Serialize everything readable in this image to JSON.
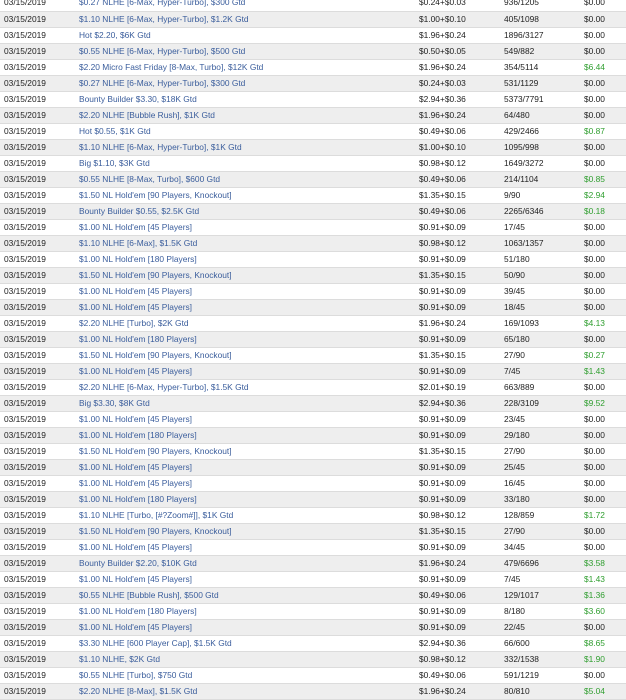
{
  "colors": {
    "link": "#3a5d9c",
    "win": "#2f9e2f",
    "row_alt": "#eeeeee"
  },
  "rows": [
    {
      "date": "03/15/2019",
      "name": "$0.27 NLHE [6-Max, Hyper-Turbo], $300 Gtd",
      "buyin": "$0.24+$0.03",
      "position": "936/1205",
      "winnings": "$0.00"
    },
    {
      "date": "03/15/2019",
      "name": "$1.10 NLHE [6-Max, Hyper-Turbo], $1.2K Gtd",
      "buyin": "$1.00+$0.10",
      "position": "405/1098",
      "winnings": "$0.00"
    },
    {
      "date": "03/15/2019",
      "name": "Hot $2.20, $6K Gtd",
      "buyin": "$1.96+$0.24",
      "position": "1896/3127",
      "winnings": "$0.00"
    },
    {
      "date": "03/15/2019",
      "name": "$0.55 NLHE [6-Max, Hyper-Turbo], $500 Gtd",
      "buyin": "$0.50+$0.05",
      "position": "549/882",
      "winnings": "$0.00"
    },
    {
      "date": "03/15/2019",
      "name": "$2.20 Micro Fast Friday [8-Max, Turbo], $12K Gtd",
      "buyin": "$1.96+$0.24",
      "position": "354/5114",
      "winnings": "$6.44"
    },
    {
      "date": "03/15/2019",
      "name": "$0.27 NLHE [6-Max, Hyper-Turbo], $300 Gtd",
      "buyin": "$0.24+$0.03",
      "position": "531/1129",
      "winnings": "$0.00"
    },
    {
      "date": "03/15/2019",
      "name": "Bounty Builder $3.30, $18K Gtd",
      "buyin": "$2.94+$0.36",
      "position": "5373/7791",
      "winnings": "$0.00"
    },
    {
      "date": "03/15/2019",
      "name": "$2.20 NLHE [Bubble Rush], $1K Gtd",
      "buyin": "$1.96+$0.24",
      "position": "64/480",
      "winnings": "$0.00"
    },
    {
      "date": "03/15/2019",
      "name": "Hot $0.55, $1K Gtd",
      "buyin": "$0.49+$0.06",
      "position": "429/2466",
      "winnings": "$0.87"
    },
    {
      "date": "03/15/2019",
      "name": "$1.10 NLHE [6-Max, Hyper-Turbo], $1K Gtd",
      "buyin": "$1.00+$0.10",
      "position": "1095/998",
      "winnings": "$0.00"
    },
    {
      "date": "03/15/2019",
      "name": "Big $1.10, $3K Gtd",
      "buyin": "$0.98+$0.12",
      "position": "1649/3272",
      "winnings": "$0.00"
    },
    {
      "date": "03/15/2019",
      "name": "$0.55 NLHE [8-Max, Turbo], $600 Gtd",
      "buyin": "$0.49+$0.06",
      "position": "214/1104",
      "winnings": "$0.85"
    },
    {
      "date": "03/15/2019",
      "name": "$1.50 NL Hold'em [90 Players, Knockout]",
      "buyin": "$1.35+$0.15",
      "position": "9/90",
      "winnings": "$2.94"
    },
    {
      "date": "03/15/2019",
      "name": "Bounty Builder $0.55, $2.5K Gtd",
      "buyin": "$0.49+$0.06",
      "position": "2265/6346",
      "winnings": "$0.18"
    },
    {
      "date": "03/15/2019",
      "name": "$1.00 NL Hold'em [45 Players]",
      "buyin": "$0.91+$0.09",
      "position": "17/45",
      "winnings": "$0.00"
    },
    {
      "date": "03/15/2019",
      "name": "$1.10 NLHE [6-Max], $1.5K Gtd",
      "buyin": "$0.98+$0.12",
      "position": "1063/1357",
      "winnings": "$0.00"
    },
    {
      "date": "03/15/2019",
      "name": "$1.00 NL Hold'em [180 Players]",
      "buyin": "$0.91+$0.09",
      "position": "51/180",
      "winnings": "$0.00"
    },
    {
      "date": "03/15/2019",
      "name": "$1.50 NL Hold'em [90 Players, Knockout]",
      "buyin": "$1.35+$0.15",
      "position": "50/90",
      "winnings": "$0.00"
    },
    {
      "date": "03/15/2019",
      "name": "$1.00 NL Hold'em [45 Players]",
      "buyin": "$0.91+$0.09",
      "position": "39/45",
      "winnings": "$0.00"
    },
    {
      "date": "03/15/2019",
      "name": "$1.00 NL Hold'em [45 Players]",
      "buyin": "$0.91+$0.09",
      "position": "18/45",
      "winnings": "$0.00"
    },
    {
      "date": "03/15/2019",
      "name": "$2.20 NLHE [Turbo], $2K Gtd",
      "buyin": "$1.96+$0.24",
      "position": "169/1093",
      "winnings": "$4.13"
    },
    {
      "date": "03/15/2019",
      "name": "$1.00 NL Hold'em [180 Players]",
      "buyin": "$0.91+$0.09",
      "position": "65/180",
      "winnings": "$0.00"
    },
    {
      "date": "03/15/2019",
      "name": "$1.50 NL Hold'em [90 Players, Knockout]",
      "buyin": "$1.35+$0.15",
      "position": "27/90",
      "winnings": "$0.27"
    },
    {
      "date": "03/15/2019",
      "name": "$1.00 NL Hold'em [45 Players]",
      "buyin": "$0.91+$0.09",
      "position": "7/45",
      "winnings": "$1.43"
    },
    {
      "date": "03/15/2019",
      "name": "$2.20 NLHE [6-Max, Hyper-Turbo], $1.5K Gtd",
      "buyin": "$2.01+$0.19",
      "position": "663/889",
      "winnings": "$0.00"
    },
    {
      "date": "03/15/2019",
      "name": "Big $3.30, $8K Gtd",
      "buyin": "$2.94+$0.36",
      "position": "228/3109",
      "winnings": "$9.52"
    },
    {
      "date": "03/15/2019",
      "name": "$1.00 NL Hold'em [45 Players]",
      "buyin": "$0.91+$0.09",
      "position": "23/45",
      "winnings": "$0.00"
    },
    {
      "date": "03/15/2019",
      "name": "$1.00 NL Hold'em [180 Players]",
      "buyin": "$0.91+$0.09",
      "position": "29/180",
      "winnings": "$0.00"
    },
    {
      "date": "03/15/2019",
      "name": "$1.50 NL Hold'em [90 Players, Knockout]",
      "buyin": "$1.35+$0.15",
      "position": "27/90",
      "winnings": "$0.00"
    },
    {
      "date": "03/15/2019",
      "name": "$1.00 NL Hold'em [45 Players]",
      "buyin": "$0.91+$0.09",
      "position": "25/45",
      "winnings": "$0.00"
    },
    {
      "date": "03/15/2019",
      "name": "$1.00 NL Hold'em [45 Players]",
      "buyin": "$0.91+$0.09",
      "position": "16/45",
      "winnings": "$0.00"
    },
    {
      "date": "03/15/2019",
      "name": "$1.00 NL Hold'em [180 Players]",
      "buyin": "$0.91+$0.09",
      "position": "33/180",
      "winnings": "$0.00"
    },
    {
      "date": "03/15/2019",
      "name": "$1.10 NLHE [Turbo, [#?Zoom#]], $1K Gtd",
      "buyin": "$0.98+$0.12",
      "position": "128/859",
      "winnings": "$1.72"
    },
    {
      "date": "03/15/2019",
      "name": "$1.50 NL Hold'em [90 Players, Knockout]",
      "buyin": "$1.35+$0.15",
      "position": "27/90",
      "winnings": "$0.00"
    },
    {
      "date": "03/15/2019",
      "name": "$1.00 NL Hold'em [45 Players]",
      "buyin": "$0.91+$0.09",
      "position": "34/45",
      "winnings": "$0.00"
    },
    {
      "date": "03/15/2019",
      "name": "Bounty Builder $2.20, $10K Gtd",
      "buyin": "$1.96+$0.24",
      "position": "479/6696",
      "winnings": "$3.58"
    },
    {
      "date": "03/15/2019",
      "name": "$1.00 NL Hold'em [45 Players]",
      "buyin": "$0.91+$0.09",
      "position": "7/45",
      "winnings": "$1.43"
    },
    {
      "date": "03/15/2019",
      "name": "$0.55 NLHE [Bubble Rush], $500 Gtd",
      "buyin": "$0.49+$0.06",
      "position": "129/1017",
      "winnings": "$1.36"
    },
    {
      "date": "03/15/2019",
      "name": "$1.00 NL Hold'em [180 Players]",
      "buyin": "$0.91+$0.09",
      "position": "8/180",
      "winnings": "$3.60"
    },
    {
      "date": "03/15/2019",
      "name": "$1.00 NL Hold'em [45 Players]",
      "buyin": "$0.91+$0.09",
      "position": "22/45",
      "winnings": "$0.00"
    },
    {
      "date": "03/15/2019",
      "name": "$3.30 NLHE [600 Player Cap], $1.5K Gtd",
      "buyin": "$2.94+$0.36",
      "position": "66/600",
      "winnings": "$8.65"
    },
    {
      "date": "03/15/2019",
      "name": "$1.10 NLHE, $2K Gtd",
      "buyin": "$0.98+$0.12",
      "position": "332/1538",
      "winnings": "$1.90"
    },
    {
      "date": "03/15/2019",
      "name": "$0.55 NLHE [Turbo], $750 Gtd",
      "buyin": "$0.49+$0.06",
      "position": "591/1219",
      "winnings": "$0.00"
    },
    {
      "date": "03/15/2019",
      "name": "$2.20 NLHE [8-Max], $1.5K Gtd",
      "buyin": "$1.96+$0.24",
      "position": "80/810",
      "winnings": "$5.04"
    }
  ]
}
